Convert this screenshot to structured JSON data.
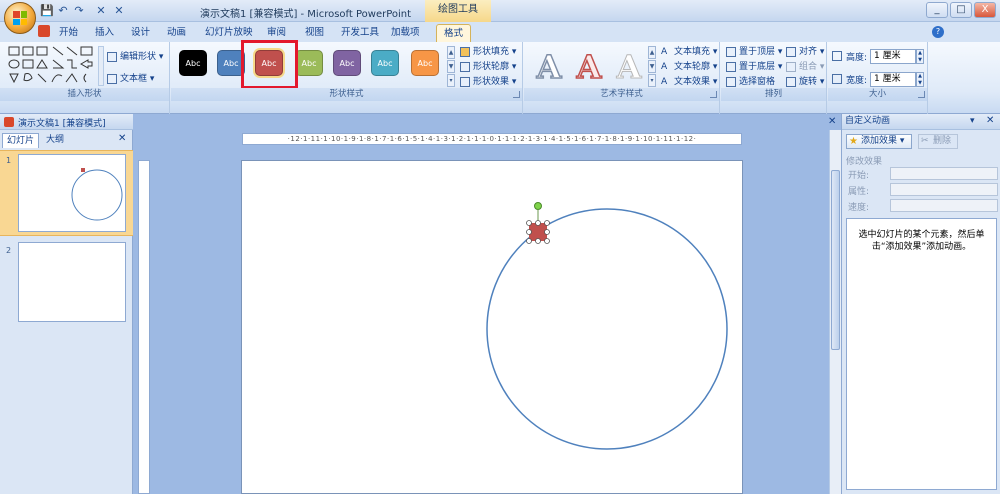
{
  "window": {
    "title": "演示文稿1 [兼容模式] - Microsoft PowerPoint",
    "context_tab_title": "绘图工具",
    "minimize_label": "_",
    "maximize_label": "□",
    "close_label": "X"
  },
  "quick_access": [
    "💾",
    "↶",
    "↷",
    "✕",
    "✕"
  ],
  "tabs": [
    {
      "label": "开始"
    },
    {
      "label": "插入"
    },
    {
      "label": "设计"
    },
    {
      "label": "动画"
    },
    {
      "label": "幻灯片放映"
    },
    {
      "label": "审阅"
    },
    {
      "label": "视图"
    },
    {
      "label": "开发工具"
    },
    {
      "label": "加载项"
    },
    {
      "label": "格式"
    }
  ],
  "ribbon": {
    "insert_shapes": {
      "label": "插入形状",
      "edit_shape": "编辑形状",
      "text_box": "文本框"
    },
    "shape_styles": {
      "label": "形状样式",
      "styles": [
        {
          "text": "Abc",
          "color": "#000000"
        },
        {
          "text": "Abc",
          "color": "#4f81bd"
        },
        {
          "text": "Abc",
          "color": "#c0504d"
        },
        {
          "text": "Abc",
          "color": "#9bbb59"
        },
        {
          "text": "Abc",
          "color": "#8064a2"
        },
        {
          "text": "Abc",
          "color": "#4bacc6"
        },
        {
          "text": "Abc",
          "color": "#f79646"
        }
      ],
      "selected_index": 2,
      "highlight_color": "#e3182d",
      "fill": "形状填充",
      "outline": "形状轮廓",
      "effects": "形状效果"
    },
    "wordart": {
      "label": "艺术字样式",
      "letters": [
        "A",
        "A",
        "A"
      ],
      "text_fill": "文本填充",
      "text_outline": "文本轮廓",
      "text_effects": "文本效果"
    },
    "arrange": {
      "label": "排列",
      "bring_front": "置于顶层",
      "send_back": "置于底层",
      "selection_pane": "选择窗格",
      "align": "对齐",
      "group": "组合",
      "rotate": "旋转"
    },
    "size": {
      "label": "大小",
      "height_label": "高度:",
      "height_value": "1 厘米",
      "width_label": "宽度:",
      "width_value": "1 厘米"
    }
  },
  "left_pane": {
    "doc_title": "演示文稿1 [兼容模式]",
    "tab_slides": "幻灯片",
    "tab_outline": "大纲",
    "close": "✕",
    "slide_numbers": [
      "1",
      "2"
    ]
  },
  "ruler": {
    "horizontal": "·12·1·11·1·10·1·9·1·8·1·7·1·6·1·5·1·4·1·3·1·2·1·1·1·0·1·1·1·2·1·3·1·4·1·5·1·6·1·7·1·8·1·9·1·10·1·11·1·12·"
  },
  "slide": {
    "circle_color": "#4f81bd",
    "shape_fill": "#c0504d"
  },
  "right_pane": {
    "title": "自定义动画",
    "close": "✕",
    "add_effect": "添加效果",
    "remove": "删除",
    "modify_label": "修改效果",
    "start_label": "开始:",
    "property_label": "属性:",
    "speed_label": "速度:",
    "hint": "选中幻灯片的某个元素，然后单击“添加效果”添加动画。"
  }
}
